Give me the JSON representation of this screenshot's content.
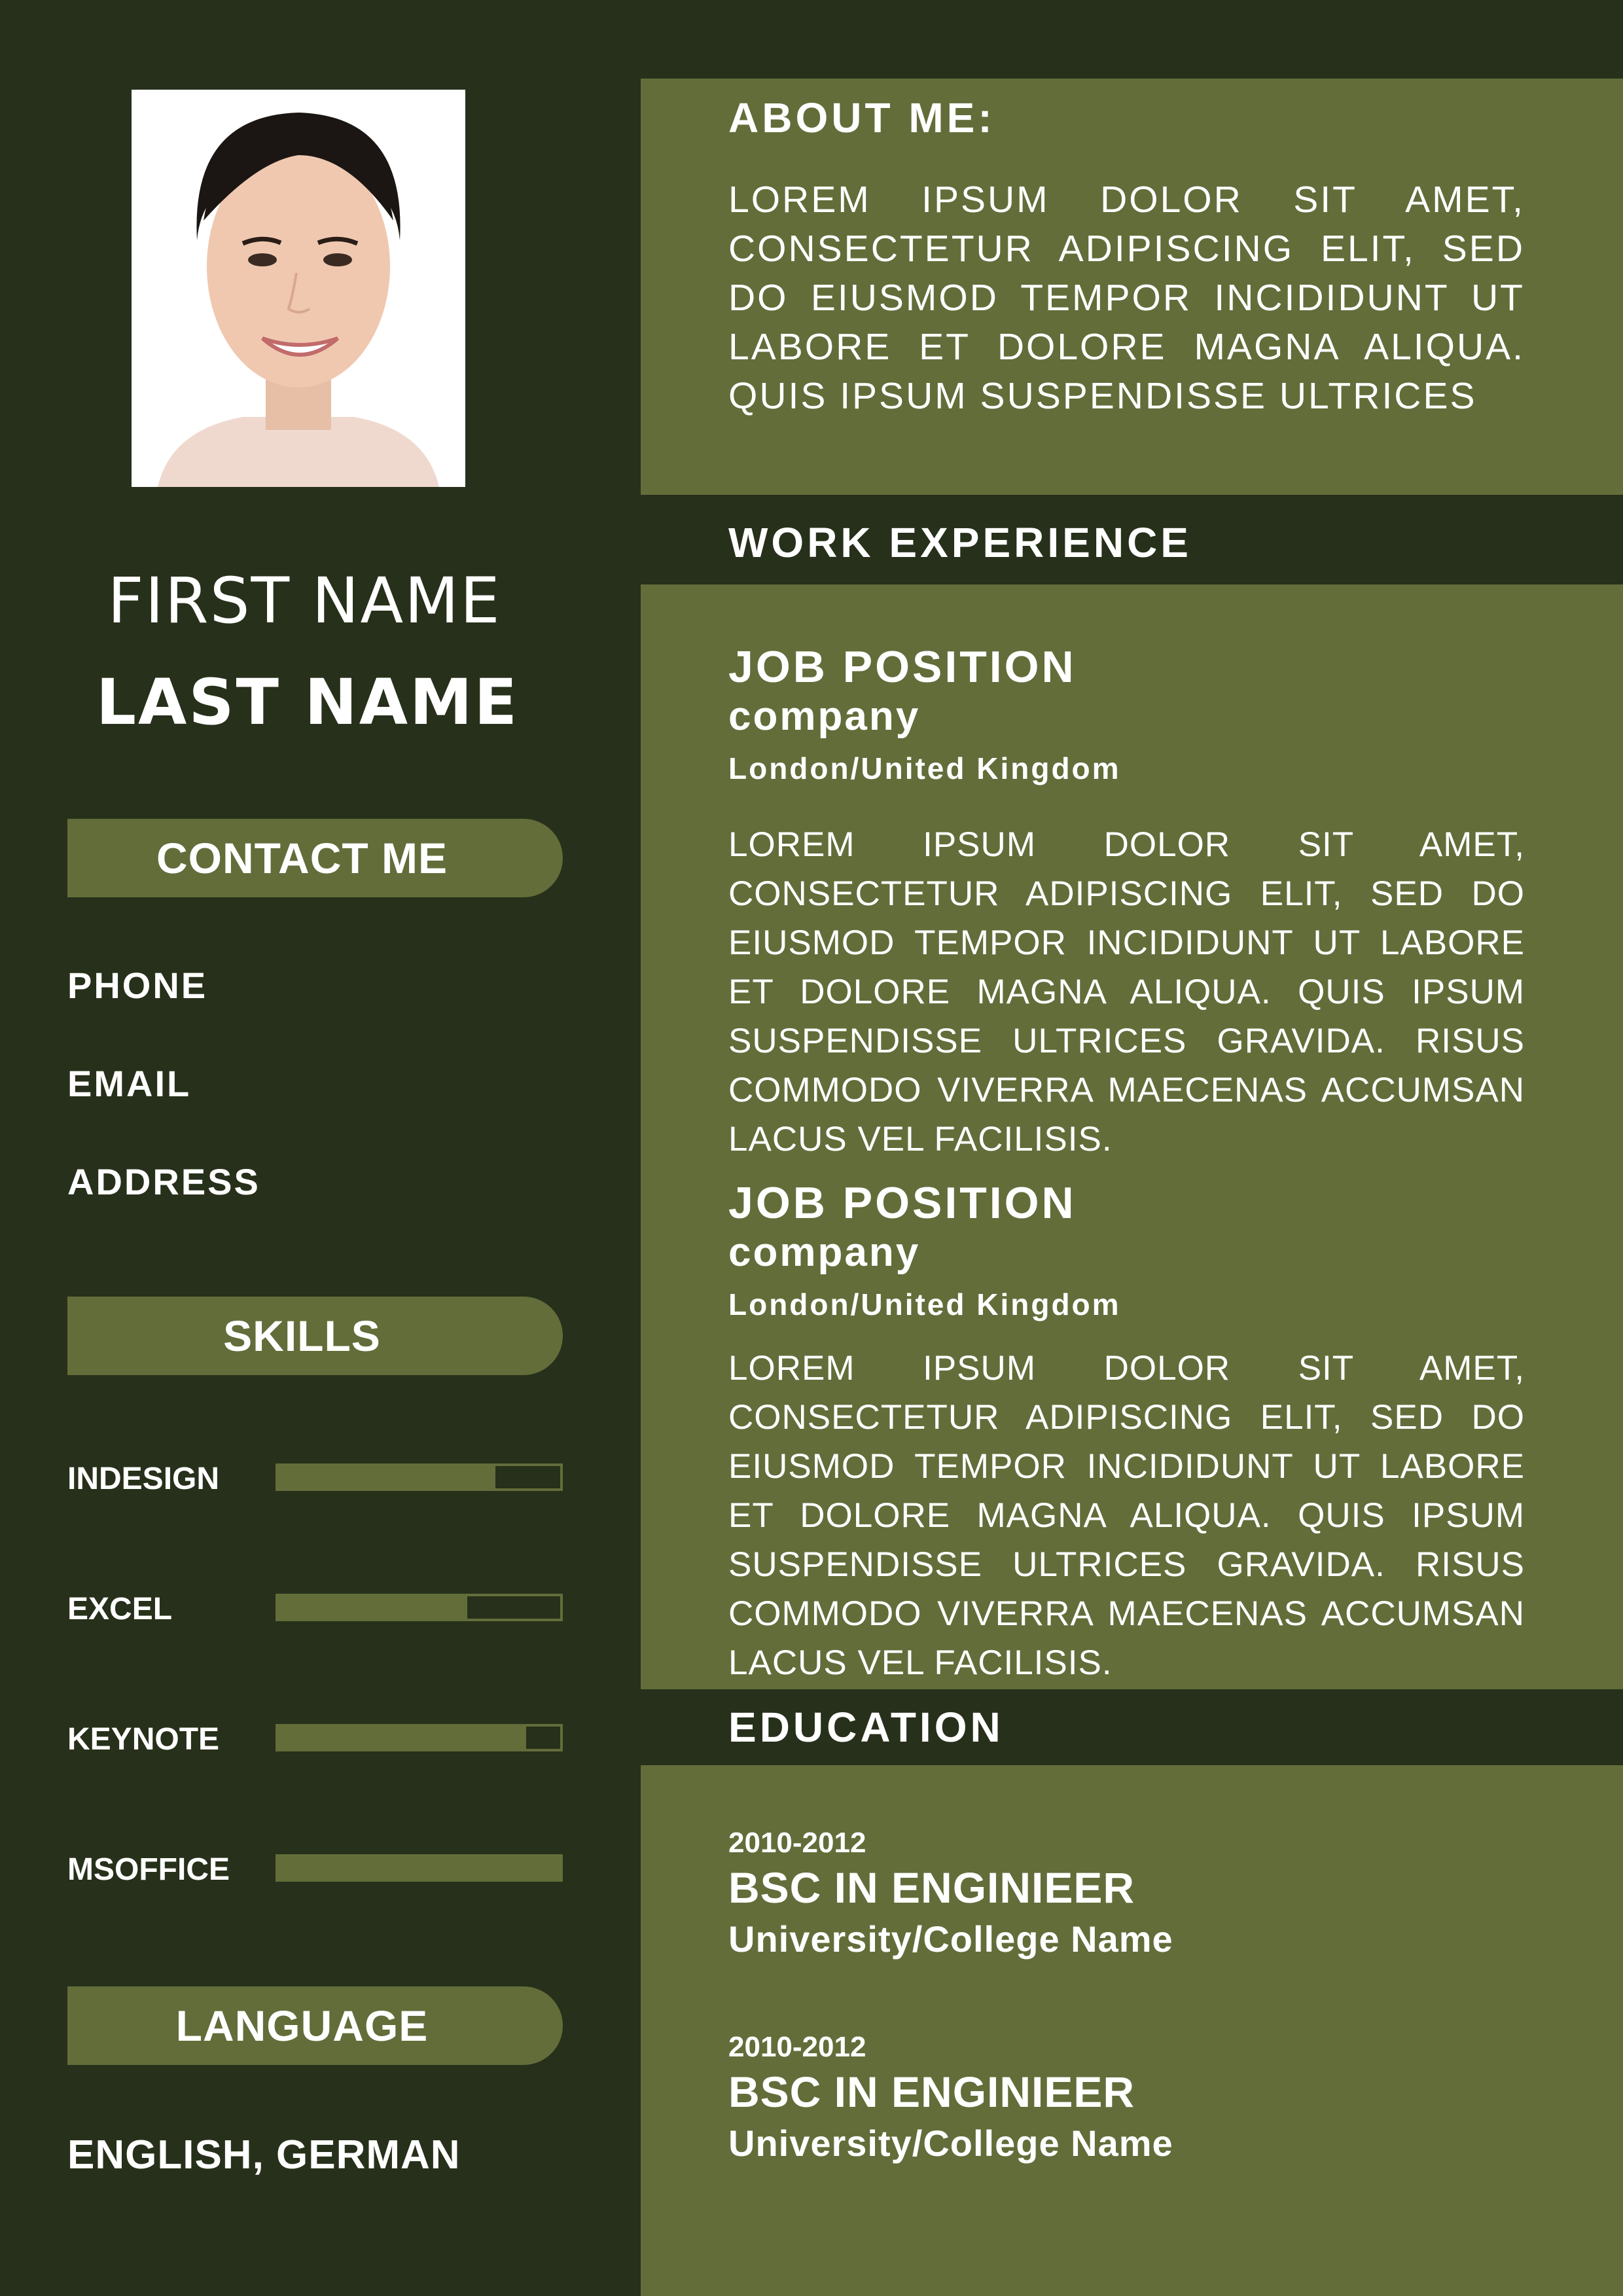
{
  "profile": {
    "first_name": "FIRST NAME",
    "last_name": "LAST NAME"
  },
  "contact": {
    "heading": "CONTACT ME",
    "items": [
      "PHONE",
      "EMAIL",
      "ADDRESS"
    ]
  },
  "skills": {
    "heading": "SKILLS",
    "items": [
      {
        "name": "INDESIGN",
        "level": 0.77
      },
      {
        "name": "EXCEL",
        "level": 0.67
      },
      {
        "name": "KEYNOTE",
        "level": 0.88
      },
      {
        "name": "MSOFFICE",
        "level": 1.0
      }
    ]
  },
  "language": {
    "heading": "LANGUAGE",
    "value": "ENGLISH, GERMAN"
  },
  "about": {
    "heading": "ABOUT ME:",
    "text": "LOREM IPSUM DOLOR SIT AMET, CONSECTETUR ADIPISCING ELIT, SED DO EIUSMOD TEMPOR INCIDIDUNT UT LABORE ET DOLORE MAGNA ALIQUA. QUIS IPSUM SUSPENDISSE ULTRICES"
  },
  "work": {
    "heading": "WORK EXPERIENCE",
    "jobs": [
      {
        "title": "JOB POSITION",
        "company": "company",
        "location": "London/United Kingdom",
        "description": "LOREM IPSUM DOLOR SIT AMET, CONSECTETUR ADIPISCING ELIT, SED DO EIUSMOD TEMPOR INCIDIDUNT UT LABORE ET DOLORE MAGNA ALIQUA. QUIS IPSUM SUSPENDISSE ULTRICES GRAVIDA. RISUS COMMODO VIVERRA MAECENAS ACCUMSAN LACUS VEL FACILISIS."
      },
      {
        "title": "JOB POSITION",
        "company": "company",
        "location": "London/United Kingdom",
        "description": "LOREM IPSUM DOLOR SIT AMET, CONSECTETUR ADIPISCING ELIT, SED DO EIUSMOD TEMPOR INCIDIDUNT UT LABORE ET DOLORE MAGNA ALIQUA. QUIS IPSUM SUSPENDISSE ULTRICES GRAVIDA. RISUS COMMODO VIVERRA MAECENAS ACCUMSAN LACUS VEL FACILISIS."
      }
    ]
  },
  "education": {
    "heading": "EDUCATION",
    "entries": [
      {
        "years": "2010-2012",
        "degree": "BSC IN ENGINIEER",
        "school": "University/College Name"
      },
      {
        "years": "2010-2012",
        "degree": "BSC IN ENGINIEER",
        "school": "University/College Name"
      }
    ]
  },
  "colors": {
    "sidebar_background": "#27301a",
    "panel_background": "#626d3a",
    "text": "#ffffff"
  }
}
